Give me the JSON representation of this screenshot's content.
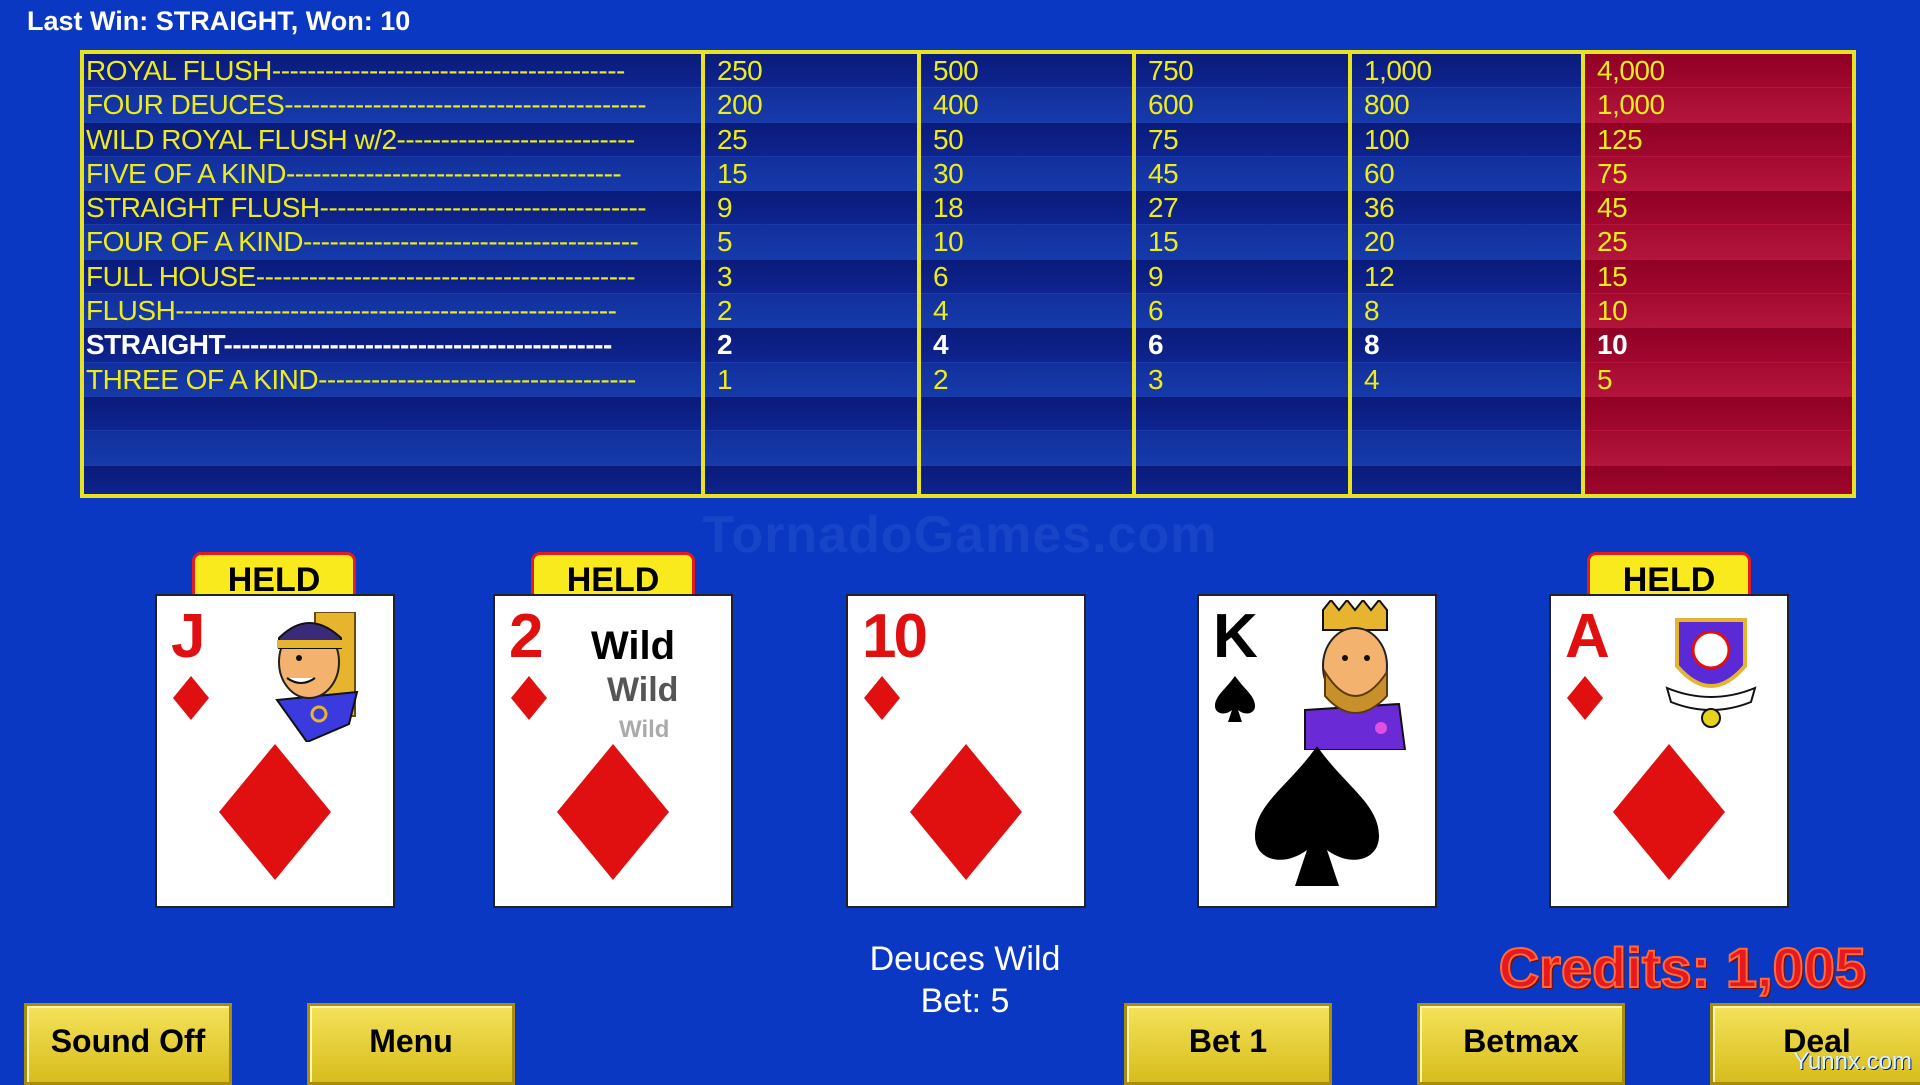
{
  "status": {
    "last_win": "Last Win: STRAIGHT, Won: 10"
  },
  "paytable": {
    "hands": [
      "ROYAL FLUSH----------------------------------------",
      "FOUR DEUCES-----------------------------------------",
      "WILD ROYAL FLUSH w/2---------------------------",
      "FIVE OF A KIND--------------------------------------",
      "STRAIGHT FLUSH-------------------------------------",
      "FOUR OF A KIND--------------------------------------",
      "FULL HOUSE-------------------------------------------",
      "FLUSH--------------------------------------------------",
      "STRAIGHT--------------------------------------------",
      "THREE OF A KIND------------------------------------"
    ],
    "columns": [
      [
        "250",
        "200",
        "25",
        "15",
        "9",
        "5",
        "3",
        "2",
        "2",
        "1"
      ],
      [
        "500",
        "400",
        "50",
        "30",
        "18",
        "10",
        "6",
        "4",
        "4",
        "2"
      ],
      [
        "750",
        "600",
        "75",
        "45",
        "27",
        "15",
        "9",
        "6",
        "6",
        "3"
      ],
      [
        "1,000",
        "800",
        "100",
        "60",
        "36",
        "20",
        "12",
        "8",
        "8",
        "4"
      ],
      [
        "4,000",
        "1,000",
        "125",
        "75",
        "45",
        "25",
        "15",
        "10",
        "10",
        "5"
      ]
    ],
    "win_row_index": 8,
    "highlight_column_color": "#a10830"
  },
  "watermark": "TornadoGames.com",
  "cards": [
    {
      "rank": "J",
      "suit": "diamond",
      "color": "red",
      "held": true,
      "face": "jack"
    },
    {
      "rank": "2",
      "suit": "diamond",
      "color": "red",
      "held": true,
      "wild_text": [
        "Wild",
        "Wild",
        "Wild"
      ]
    },
    {
      "rank": "10",
      "suit": "diamond",
      "color": "red",
      "held": false
    },
    {
      "rank": "K",
      "suit": "spade",
      "color": "black",
      "held": false,
      "face": "king"
    },
    {
      "rank": "A",
      "suit": "diamond",
      "color": "red",
      "held": true,
      "face": "crest"
    }
  ],
  "held_label": "HELD",
  "game": {
    "name": "Deuces Wild",
    "bet": "Bet: 5"
  },
  "credits": "Credits: 1,005",
  "buttons": {
    "sound": "Sound Off",
    "menu": "Menu",
    "bet1": "Bet 1",
    "betmax": "Betmax",
    "deal": "Deal"
  },
  "corner_mark": "Yunnx.com",
  "colors": {
    "background": "#0a38c2",
    "paytable_text": "#ecec1c",
    "held_bg": "#f8ea1c",
    "button_bg": "#e6cf3a"
  }
}
